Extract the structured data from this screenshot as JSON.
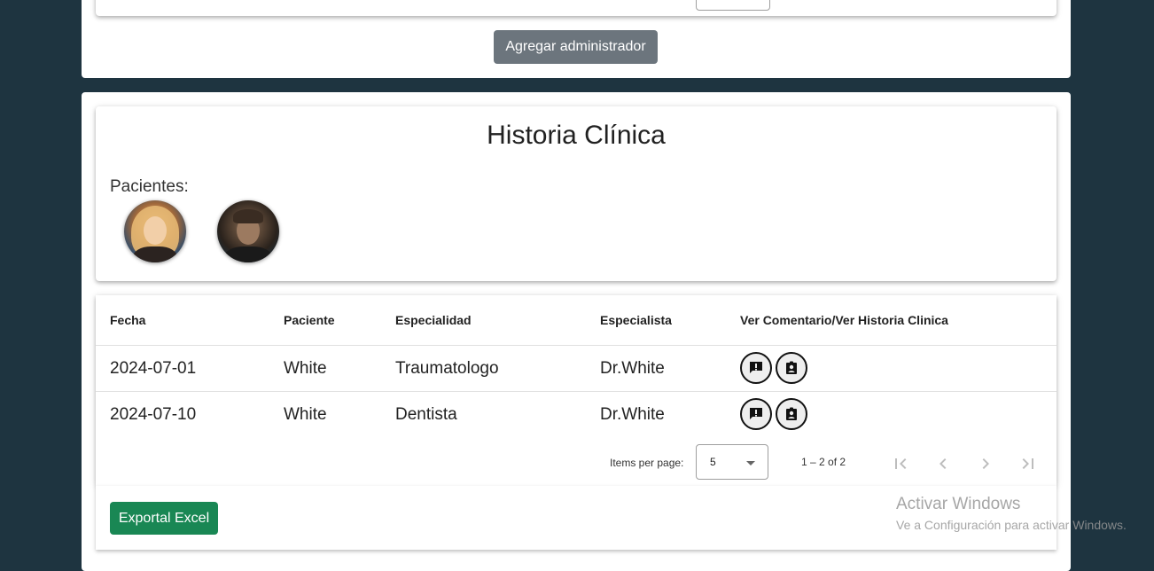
{
  "admin_section": {
    "add_admin_button": "Agregar administrador"
  },
  "historia": {
    "title": "Historia Clínica",
    "patients_label": "Pacientes:",
    "patients": [
      {
        "avatar": "patient-avatar-woman"
      },
      {
        "avatar": "patient-avatar-man"
      }
    ]
  },
  "table": {
    "headers": [
      "Fecha",
      "Paciente",
      "Especialidad",
      "Especialista",
      "Ver Comentario/Ver Historia Clinica"
    ],
    "rows": [
      {
        "fecha": "2024-07-01",
        "paciente": "White",
        "especialidad": "Traumatologo",
        "especialista": "Dr.White",
        "icons": [
          "comment-alert-icon",
          "clinical-record-icon"
        ]
      },
      {
        "fecha": "2024-07-10",
        "paciente": "White",
        "especialidad": "Dentista",
        "especialista": "Dr.White",
        "icons": [
          "comment-alert-icon",
          "clinical-record-icon"
        ]
      }
    ]
  },
  "paginator": {
    "items_per_page_label": "Items per page:",
    "page_size": "5",
    "range_label": "1 – 2 of 2",
    "icons": [
      "first-page-icon",
      "previous-page-icon",
      "next-page-icon",
      "last-page-icon"
    ]
  },
  "export_button": "Exportal Excel",
  "watermark": {
    "title": "Activar Windows",
    "subtitle": "Ve a Configuración para activar Windows."
  },
  "colors": {
    "background": "#1e3440",
    "grey_button": "#6c757d",
    "green_button": "#198754"
  }
}
